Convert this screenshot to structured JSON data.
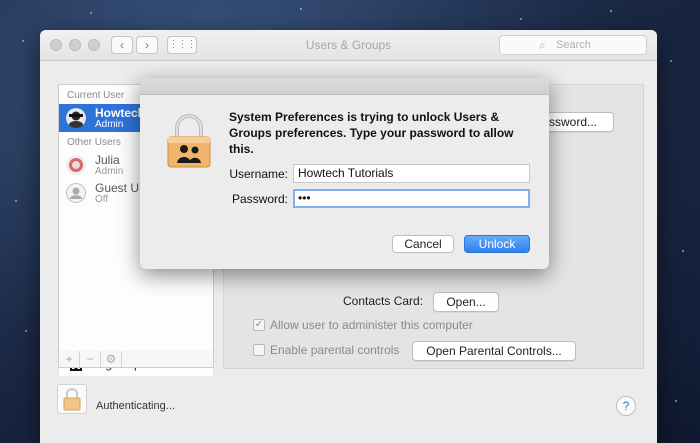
{
  "window": {
    "title": "Users & Groups",
    "search_placeholder": "Search",
    "nav_back": "‹",
    "nav_forward": "›",
    "grid_glyph": "⋮⋮⋮"
  },
  "sidebar": {
    "current_user_header": "Current User",
    "current_user": {
      "name": "Howtech",
      "role": "Admin"
    },
    "other_users_header": "Other Users",
    "other_users": [
      {
        "name": "Julia",
        "role": "Admin"
      },
      {
        "name": "Guest U",
        "role": "Off"
      }
    ],
    "login_options_label": "Login Options",
    "add_glyph": "+",
    "remove_glyph": "−",
    "action_glyph": "⚙"
  },
  "panel": {
    "password_button_label": "ssword...",
    "contacts_card_label": "Contacts Card:",
    "contacts_open_button": "Open...",
    "allow_admin_label": "Allow user to administer this computer",
    "allow_admin_checked": true,
    "parental_controls_label": "Enable parental controls",
    "parental_controls_checked": false,
    "open_parental_button": "Open Parental Controls..."
  },
  "footer": {
    "status_text": "Authenticating...",
    "help_glyph": "?"
  },
  "dialog": {
    "message": "System Preferences is trying to unlock Users & Groups preferences. Type your password to allow this.",
    "username_label": "Username:",
    "username_value": "Howtech Tutorials",
    "password_label": "Password:",
    "password_value": "•••",
    "cancel_label": "Cancel",
    "unlock_label": "Unlock"
  },
  "colors": {
    "accent": "#2d73d8",
    "unlock_button": "#3a88f2"
  },
  "icons": {
    "search": "search-icon",
    "lock": "lock-icon",
    "help": "help-icon",
    "house": "house-icon"
  }
}
